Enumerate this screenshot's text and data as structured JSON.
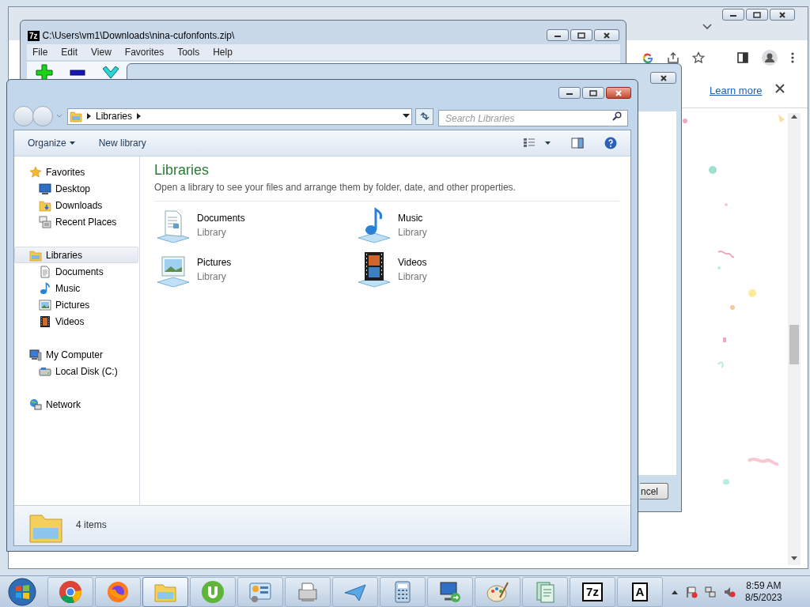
{
  "browser": {
    "link": "Learn more"
  },
  "dialog": {
    "button": "ncel"
  },
  "archiver": {
    "icon_label": "7z",
    "title": "C:\\Users\\vm1\\Downloads\\nina-cufonfonts.zip\\",
    "menu": [
      "File",
      "Edit",
      "View",
      "Favorites",
      "Tools",
      "Help"
    ]
  },
  "explorer": {
    "breadcrumb": "Libraries",
    "search": {
      "placeholder": "Search Libraries"
    },
    "commands": [
      "Organize",
      "New library"
    ],
    "nav": [
      {
        "label": "Favorites",
        "kind": "star",
        "selected": false,
        "children": [
          {
            "label": "Desktop",
            "kind": "desktop",
            "selected": false
          },
          {
            "label": "Downloads",
            "kind": "downloads",
            "selected": false
          },
          {
            "label": "Recent Places",
            "kind": "recent",
            "selected": false
          }
        ]
      },
      {
        "label": "Libraries",
        "kind": "libraries",
        "selected": true,
        "children": [
          {
            "label": "Documents",
            "kind": "documents",
            "selected": false
          },
          {
            "label": "Music",
            "kind": "music",
            "selected": false
          },
          {
            "label": "Pictures",
            "kind": "pictures",
            "selected": false
          },
          {
            "label": "Videos",
            "kind": "videos",
            "selected": false
          }
        ]
      },
      {
        "label": "My Computer",
        "kind": "computer",
        "selected": false,
        "children": [
          {
            "label": "Local Disk (C:)",
            "kind": "disk",
            "selected": false
          }
        ]
      },
      {
        "label": "Network",
        "kind": "network",
        "selected": false
      }
    ],
    "heading": "Libraries",
    "description": "Open a library to see your files and arrange them by folder, date, and other properties.",
    "libraries": [
      {
        "name": "Documents",
        "type": "Library",
        "kind": "documents"
      },
      {
        "name": "Music",
        "type": "Library",
        "kind": "music"
      },
      {
        "name": "Pictures",
        "type": "Library",
        "kind": "pictures"
      },
      {
        "name": "Videos",
        "type": "Library",
        "kind": "videos"
      }
    ],
    "status": "4 items"
  },
  "taskbar": {
    "apps": [
      {
        "kind": "chrome",
        "selected": false
      },
      {
        "kind": "firefox",
        "selected": false
      },
      {
        "kind": "explorer",
        "selected": true
      },
      {
        "kind": "torrent",
        "selected": false
      },
      {
        "kind": "control",
        "selected": false
      },
      {
        "kind": "fax",
        "selected": false
      },
      {
        "kind": "plane",
        "selected": false
      },
      {
        "kind": "calculator",
        "selected": false
      },
      {
        "kind": "remote",
        "selected": false
      },
      {
        "kind": "paint",
        "selected": false
      },
      {
        "kind": "notes",
        "selected": false
      },
      {
        "kind": "text",
        "label": "7z",
        "selected": false
      },
      {
        "kind": "text",
        "label": "A",
        "selected": false
      }
    ],
    "clock": {
      "time": "8:59 AM",
      "date": "8/5/2023"
    }
  }
}
